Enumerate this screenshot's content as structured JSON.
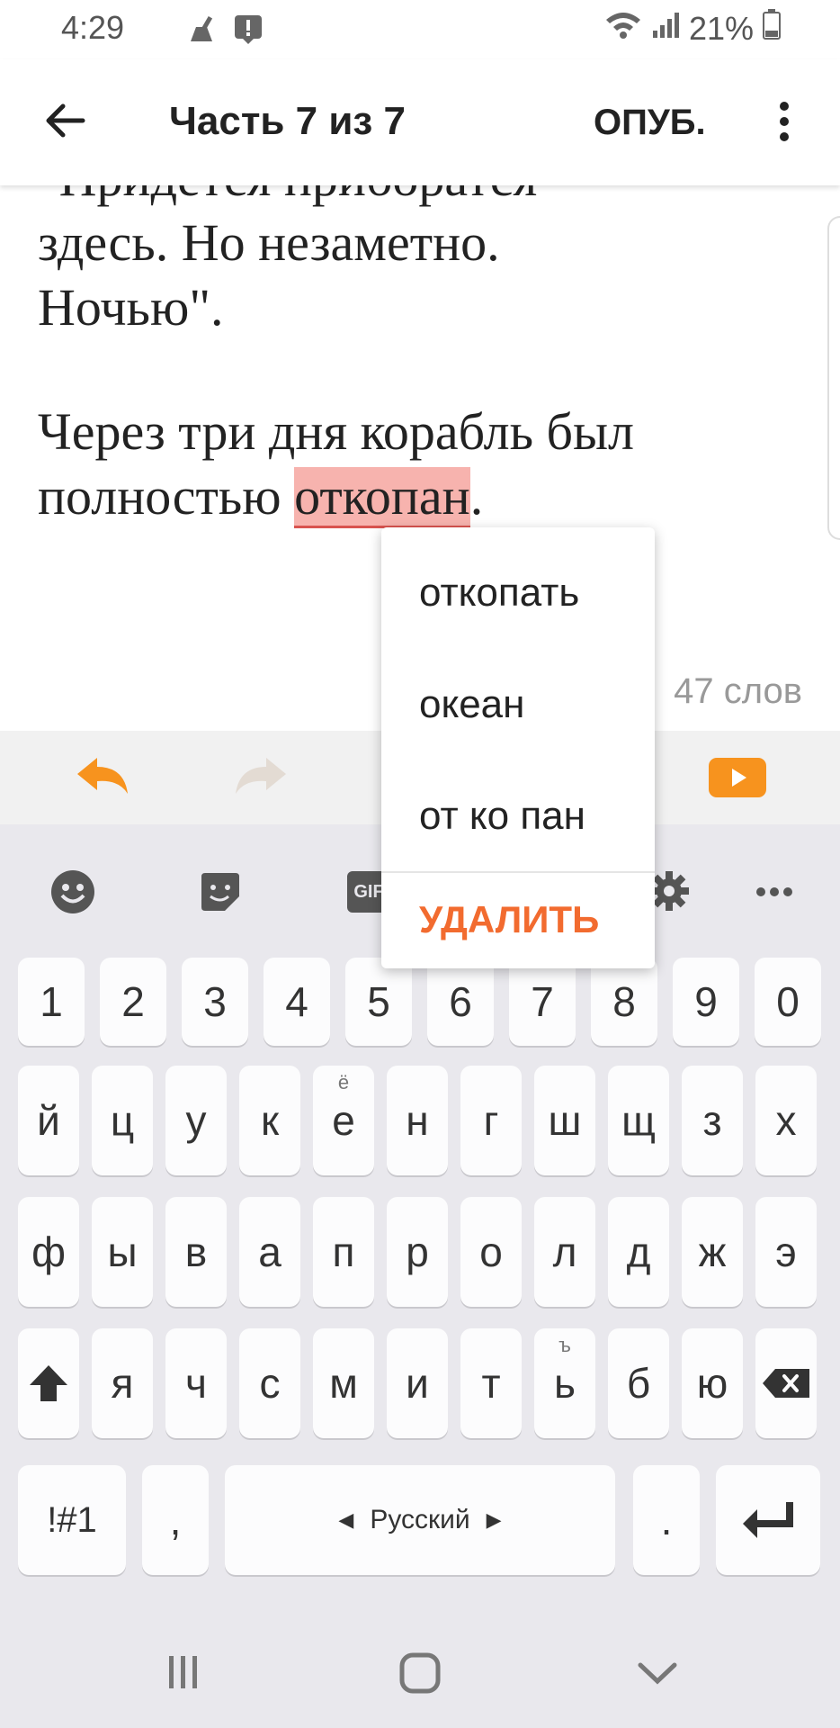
{
  "status_bar": {
    "time": "4:29",
    "battery": "21%"
  },
  "app_bar": {
    "title": "Часть 7 из 7",
    "publish_label": "ОПУБ."
  },
  "editor": {
    "partial_line": "\"Придется приборатся",
    "lines": [
      "здесь. Но незаметно.",
      "Ночью\"."
    ],
    "paragraph2_line1": "Через три дня корабль был",
    "paragraph2_line2_prefix": "полностью ",
    "misspelled_word": "откопан",
    "paragraph2_line2_suffix": ".",
    "word_count": "47 слов"
  },
  "spell_popup": {
    "suggestions": [
      "откопать",
      "океан",
      "от ко пан"
    ],
    "delete_label": "УДАЛИТЬ"
  },
  "keyboard": {
    "gif_label": "GIF",
    "number_row": [
      "1",
      "2",
      "3",
      "4",
      "5",
      "6",
      "7",
      "8",
      "9",
      "0"
    ],
    "row1": [
      "й",
      "ц",
      "у",
      "к",
      "е",
      "н",
      "г",
      "ш",
      "щ",
      "з",
      "х"
    ],
    "row1_hint_e": "ё",
    "row2": [
      "ф",
      "ы",
      "в",
      "а",
      "п",
      "р",
      "о",
      "л",
      "д",
      "ж",
      "э"
    ],
    "row3": [
      "я",
      "ч",
      "с",
      "м",
      "и",
      "т",
      "ь",
      "б",
      "ю"
    ],
    "row3_hint_soft": "ъ",
    "symbols_label": "!#1",
    "comma": ",",
    "space_label": "Русский",
    "period": "."
  },
  "colors": {
    "accent": "#f7931e",
    "delete": "#f26b2f",
    "misspelled_bg": "#f7b3ae"
  }
}
